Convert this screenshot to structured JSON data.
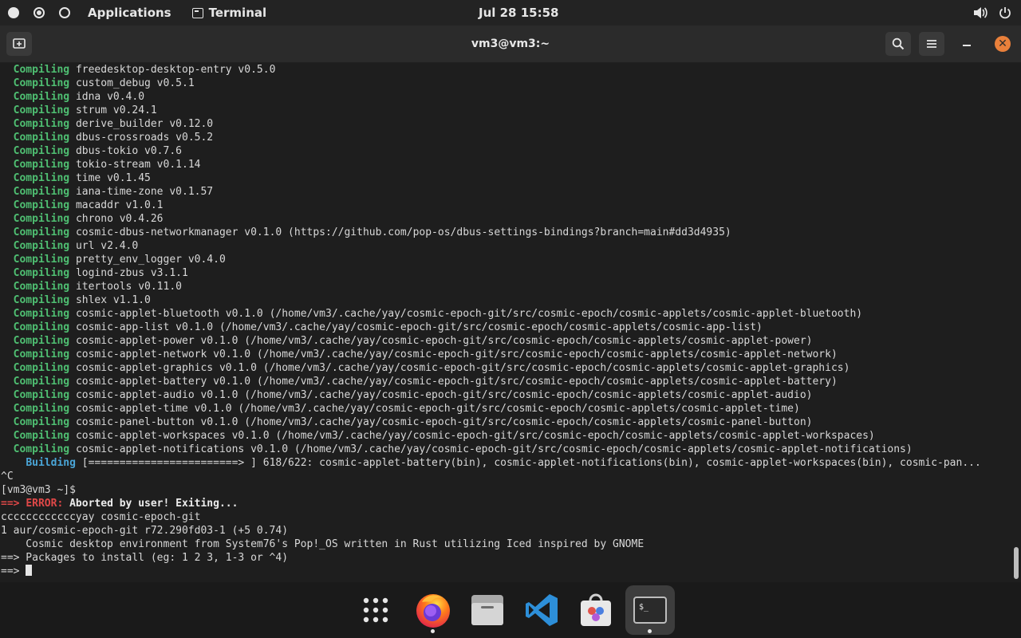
{
  "topbar": {
    "applications_label": "Applications",
    "terminal_label": "Terminal",
    "datetime": "Jul 28  15:58"
  },
  "window": {
    "title": "vm3@vm3:~"
  },
  "terminal": {
    "compiling": [
      {
        "kw": "Compiling",
        "text": "freedesktop-desktop-entry v0.5.0"
      },
      {
        "kw": "Compiling",
        "text": "custom_debug v0.5.1"
      },
      {
        "kw": "Compiling",
        "text": "idna v0.4.0"
      },
      {
        "kw": "Compiling",
        "text": "strum v0.24.1"
      },
      {
        "kw": "Compiling",
        "text": "derive_builder v0.12.0"
      },
      {
        "kw": "Compiling",
        "text": "dbus-crossroads v0.5.2"
      },
      {
        "kw": "Compiling",
        "text": "dbus-tokio v0.7.6"
      },
      {
        "kw": "Compiling",
        "text": "tokio-stream v0.1.14"
      },
      {
        "kw": "Compiling",
        "text": "time v0.1.45"
      },
      {
        "kw": "Compiling",
        "text": "iana-time-zone v0.1.57"
      },
      {
        "kw": "Compiling",
        "text": "macaddr v1.0.1"
      },
      {
        "kw": "Compiling",
        "text": "chrono v0.4.26"
      },
      {
        "kw": "Compiling",
        "text": "cosmic-dbus-networkmanager v0.1.0 (https://github.com/pop-os/dbus-settings-bindings?branch=main#dd3d4935)"
      },
      {
        "kw": "Compiling",
        "text": "url v2.4.0"
      },
      {
        "kw": "Compiling",
        "text": "pretty_env_logger v0.4.0"
      },
      {
        "kw": "Compiling",
        "text": "logind-zbus v3.1.1"
      },
      {
        "kw": "Compiling",
        "text": "itertools v0.11.0"
      },
      {
        "kw": "Compiling",
        "text": "shlex v1.1.0"
      },
      {
        "kw": "Compiling",
        "text": "cosmic-applet-bluetooth v0.1.0 (/home/vm3/.cache/yay/cosmic-epoch-git/src/cosmic-epoch/cosmic-applets/cosmic-applet-bluetooth)"
      },
      {
        "kw": "Compiling",
        "text": "cosmic-app-list v0.1.0 (/home/vm3/.cache/yay/cosmic-epoch-git/src/cosmic-epoch/cosmic-applets/cosmic-app-list)"
      },
      {
        "kw": "Compiling",
        "text": "cosmic-applet-power v0.1.0 (/home/vm3/.cache/yay/cosmic-epoch-git/src/cosmic-epoch/cosmic-applets/cosmic-applet-power)"
      },
      {
        "kw": "Compiling",
        "text": "cosmic-applet-network v0.1.0 (/home/vm3/.cache/yay/cosmic-epoch-git/src/cosmic-epoch/cosmic-applets/cosmic-applet-network)"
      },
      {
        "kw": "Compiling",
        "text": "cosmic-applet-graphics v0.1.0 (/home/vm3/.cache/yay/cosmic-epoch-git/src/cosmic-epoch/cosmic-applets/cosmic-applet-graphics)"
      },
      {
        "kw": "Compiling",
        "text": "cosmic-applet-battery v0.1.0 (/home/vm3/.cache/yay/cosmic-epoch-git/src/cosmic-epoch/cosmic-applets/cosmic-applet-battery)"
      },
      {
        "kw": "Compiling",
        "text": "cosmic-applet-audio v0.1.0 (/home/vm3/.cache/yay/cosmic-epoch-git/src/cosmic-epoch/cosmic-applets/cosmic-applet-audio)"
      },
      {
        "kw": "Compiling",
        "text": "cosmic-applet-time v0.1.0 (/home/vm3/.cache/yay/cosmic-epoch-git/src/cosmic-epoch/cosmic-applets/cosmic-applet-time)"
      },
      {
        "kw": "Compiling",
        "text": "cosmic-panel-button v0.1.0 (/home/vm3/.cache/yay/cosmic-epoch-git/src/cosmic-epoch/cosmic-applets/cosmic-panel-button)"
      },
      {
        "kw": "Compiling",
        "text": "cosmic-applet-workspaces v0.1.0 (/home/vm3/.cache/yay/cosmic-epoch-git/src/cosmic-epoch/cosmic-applets/cosmic-applet-workspaces)"
      },
      {
        "kw": "Compiling",
        "text": "cosmic-applet-notifications v0.1.0 (/home/vm3/.cache/yay/cosmic-epoch-git/src/cosmic-epoch/cosmic-applets/cosmic-applet-notifications)"
      }
    ],
    "building": {
      "kw": "Building",
      "text": "[========================> ] 618/622: cosmic-applet-battery(bin), cosmic-applet-notifications(bin), cosmic-applet-workspaces(bin), cosmic-pan..."
    },
    "interrupt": "^C",
    "prompt": "[vm3@vm3 ~]$",
    "error": {
      "arrow": "==>",
      "label": "ERROR:",
      "message": "Aborted by user! Exiting..."
    },
    "command": "ccccccccccccyay cosmic-epoch-git",
    "result": "1 aur/cosmic-epoch-git r72.290fd03-1 (+5 0.74)",
    "description": "    Cosmic desktop environment from System76's Pop!_OS written in Rust utilizing Iced inspired by GNOME",
    "install_prompt": "==> Packages to install (eg: 1 2 3, 1-3 or ^4)",
    "input_prompt": "==> "
  },
  "dock": {
    "items": [
      {
        "icon": "app-grid-icon"
      },
      {
        "icon": "firefox-icon"
      },
      {
        "icon": "files-icon"
      },
      {
        "icon": "vscode-icon"
      },
      {
        "icon": "software-store-icon"
      },
      {
        "icon": "terminal-icon"
      }
    ]
  },
  "colors": {
    "compiling": "#4fbf72",
    "building": "#4aa6d8",
    "error": "#e04848",
    "close_button": "#e9803b"
  }
}
